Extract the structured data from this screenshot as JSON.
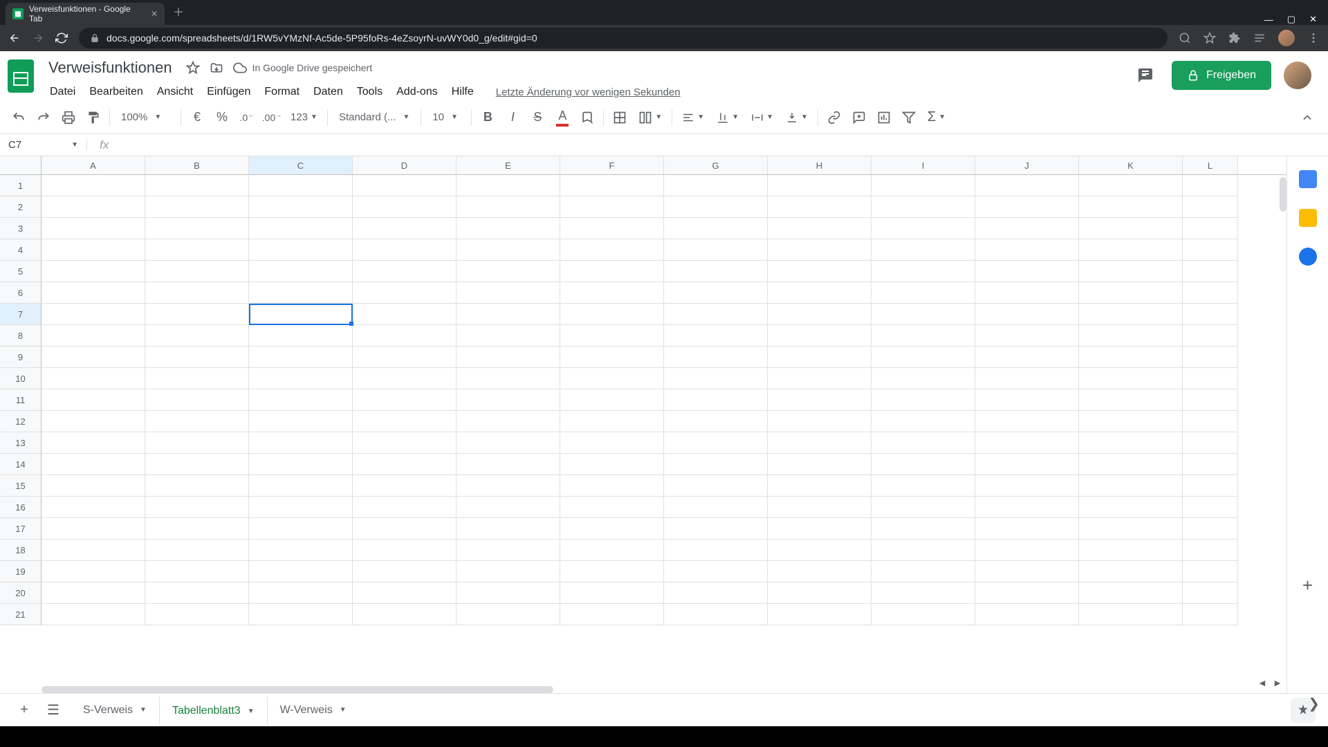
{
  "browser": {
    "tab_title": "Verweisfunktionen - Google Tab",
    "url": "docs.google.com/spreadsheets/d/1RW5vYMzNf-Ac5de-5P95foRs-4eZsoyrN-uvWY0d0_g/edit#gid=0"
  },
  "doc": {
    "title": "Verweisfunktionen",
    "drive_status": "In Google Drive gespeichert",
    "last_edit": "Letzte Änderung vor wenigen Sekunden"
  },
  "menus": [
    "Datei",
    "Bearbeiten",
    "Ansicht",
    "Einfügen",
    "Format",
    "Daten",
    "Tools",
    "Add-ons",
    "Hilfe"
  ],
  "toolbar": {
    "zoom": "100%",
    "currency": "€",
    "percent": "%",
    "dec_dec": ".0",
    "inc_dec": ".00",
    "num_format": "123",
    "font": "Standard (...",
    "font_size": "10"
  },
  "share_label": "Freigeben",
  "namebox": "C7",
  "columns": [
    "A",
    "B",
    "C",
    "D",
    "E",
    "F",
    "G",
    "H",
    "I",
    "J",
    "K",
    "L"
  ],
  "rows": [
    "1",
    "2",
    "3",
    "4",
    "5",
    "6",
    "7",
    "8",
    "9",
    "10",
    "11",
    "12",
    "13",
    "14",
    "15",
    "16",
    "17",
    "18",
    "19",
    "20",
    "21"
  ],
  "selected": {
    "col_index": 2,
    "row_index": 6
  },
  "sheet_tabs": [
    {
      "name": "S-Verweis",
      "active": false
    },
    {
      "name": "Tabellenblatt3",
      "active": true
    },
    {
      "name": "W-Verweis",
      "active": false
    }
  ]
}
